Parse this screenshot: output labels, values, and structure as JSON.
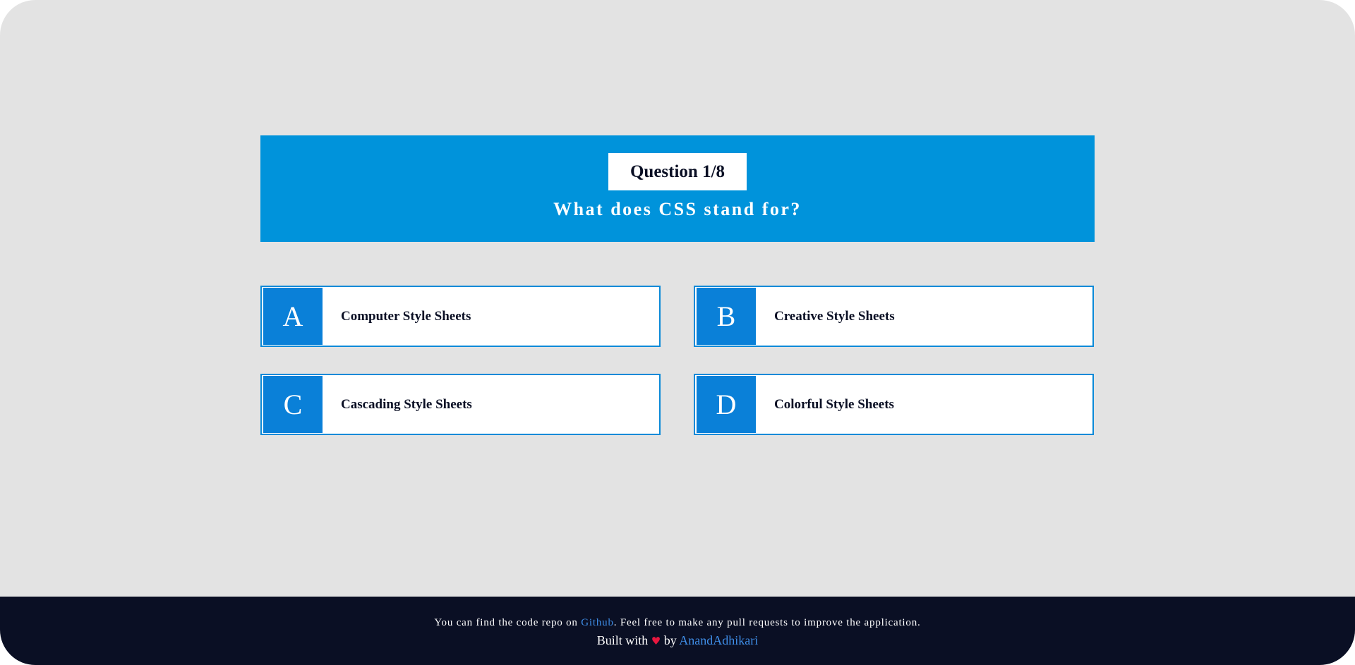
{
  "question": {
    "badge": "Question 1/8",
    "text": "What does CSS stand for?"
  },
  "options": [
    {
      "letter": "A",
      "label": "Computer Style Sheets"
    },
    {
      "letter": "B",
      "label": "Creative Style Sheets"
    },
    {
      "letter": "C",
      "label": "Cascading Style Sheets"
    },
    {
      "letter": "D",
      "label": "Colorful Style Sheets"
    }
  ],
  "footer": {
    "line1_prefix": "You can find the code repo on ",
    "line1_link": "Github",
    "line1_suffix": ". Feel free to make any pull requests to improve the application.",
    "line2_prefix": "Built with ",
    "heart_icon": "♥",
    "line2_middle": " by ",
    "line2_link": "AnandAdhikari"
  },
  "colors": {
    "background": "#e3e3e3",
    "accent": "#0093db",
    "option_letter_bg": "#0a80d8",
    "footer_bg": "#0a0f24",
    "link": "#3f8ee8",
    "heart": "#e8173f"
  }
}
